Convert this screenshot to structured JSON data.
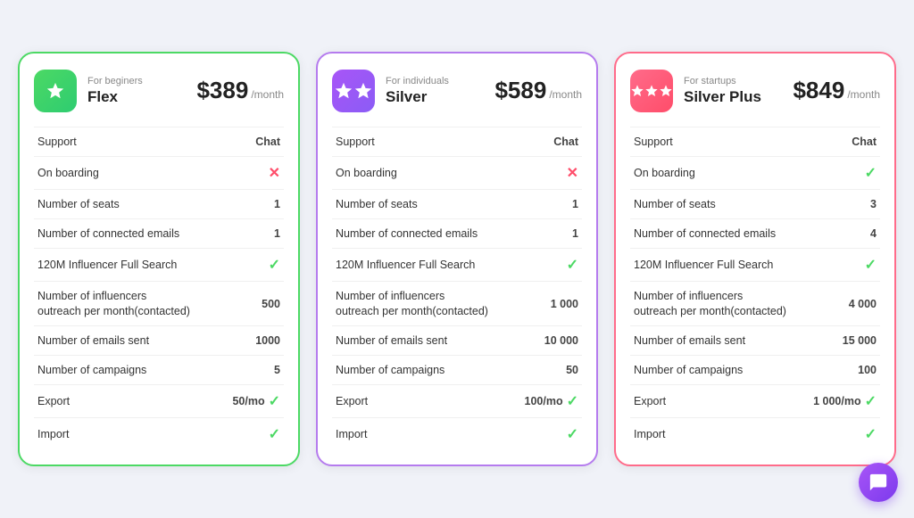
{
  "plans": [
    {
      "id": "flex",
      "tier": "For beginers",
      "name": "Flex",
      "price": "$389",
      "period": "/month",
      "icon_type": "flex-icon",
      "stars": 1,
      "border_color": "#4cd964",
      "features": [
        {
          "label": "Support",
          "value": "Chat",
          "type": "text"
        },
        {
          "label": "On boarding",
          "value": "✗",
          "type": "cross"
        },
        {
          "label": "Number of seats",
          "value": "1",
          "type": "text"
        },
        {
          "label": "Number of connected emails",
          "value": "1",
          "type": "text"
        },
        {
          "label": "120M Influencer Full Search",
          "value": "✓",
          "type": "check"
        },
        {
          "label": "Number of influencers outreach per month(contacted)",
          "value": "500",
          "type": "text"
        },
        {
          "label": "Number of emails sent",
          "value": "1000",
          "type": "text"
        },
        {
          "label": "Number of campaigns",
          "value": "5",
          "type": "text"
        },
        {
          "label": "Export",
          "value": "50/mo",
          "type": "export"
        },
        {
          "label": "Import",
          "value": "✓",
          "type": "check"
        }
      ]
    },
    {
      "id": "silver",
      "tier": "For individuals",
      "name": "Silver",
      "price": "$589",
      "period": "/month",
      "icon_type": "silver-icon",
      "stars": 2,
      "border_color": "#b57bee",
      "features": [
        {
          "label": "Support",
          "value": "Chat",
          "type": "text"
        },
        {
          "label": "On boarding",
          "value": "✗",
          "type": "cross"
        },
        {
          "label": "Number of seats",
          "value": "1",
          "type": "text"
        },
        {
          "label": "Number of connected emails",
          "value": "1",
          "type": "text"
        },
        {
          "label": "120M Influencer Full Search",
          "value": "✓",
          "type": "check"
        },
        {
          "label": "Number of influencers outreach per month(contacted)",
          "value": "1 000",
          "type": "text"
        },
        {
          "label": "Number of emails sent",
          "value": "10 000",
          "type": "text"
        },
        {
          "label": "Number of campaigns",
          "value": "50",
          "type": "text"
        },
        {
          "label": "Export",
          "value": "100/mo",
          "type": "export"
        },
        {
          "label": "Import",
          "value": "✓",
          "type": "check"
        }
      ]
    },
    {
      "id": "silver-plus",
      "tier": "For startups",
      "name": "Silver Plus",
      "price": "$849",
      "period": "/month",
      "icon_type": "silver-plus-icon",
      "stars": 3,
      "border_color": "#ff6b8a",
      "features": [
        {
          "label": "Support",
          "value": "Chat",
          "type": "text"
        },
        {
          "label": "On boarding",
          "value": "✓",
          "type": "check"
        },
        {
          "label": "Number of seats",
          "value": "3",
          "type": "text"
        },
        {
          "label": "Number of connected emails",
          "value": "4",
          "type": "text"
        },
        {
          "label": "120M Influencer Full Search",
          "value": "✓",
          "type": "check"
        },
        {
          "label": "Number of influencers outreach per month(contacted)",
          "value": "4 000",
          "type": "text"
        },
        {
          "label": "Number of emails sent",
          "value": "15 000",
          "type": "text"
        },
        {
          "label": "Number of campaigns",
          "value": "100",
          "type": "text"
        },
        {
          "label": "Export",
          "value": "1 000/mo",
          "type": "export"
        },
        {
          "label": "Import",
          "value": "✓",
          "type": "check"
        }
      ]
    }
  ],
  "chat_button_label": "Chat"
}
